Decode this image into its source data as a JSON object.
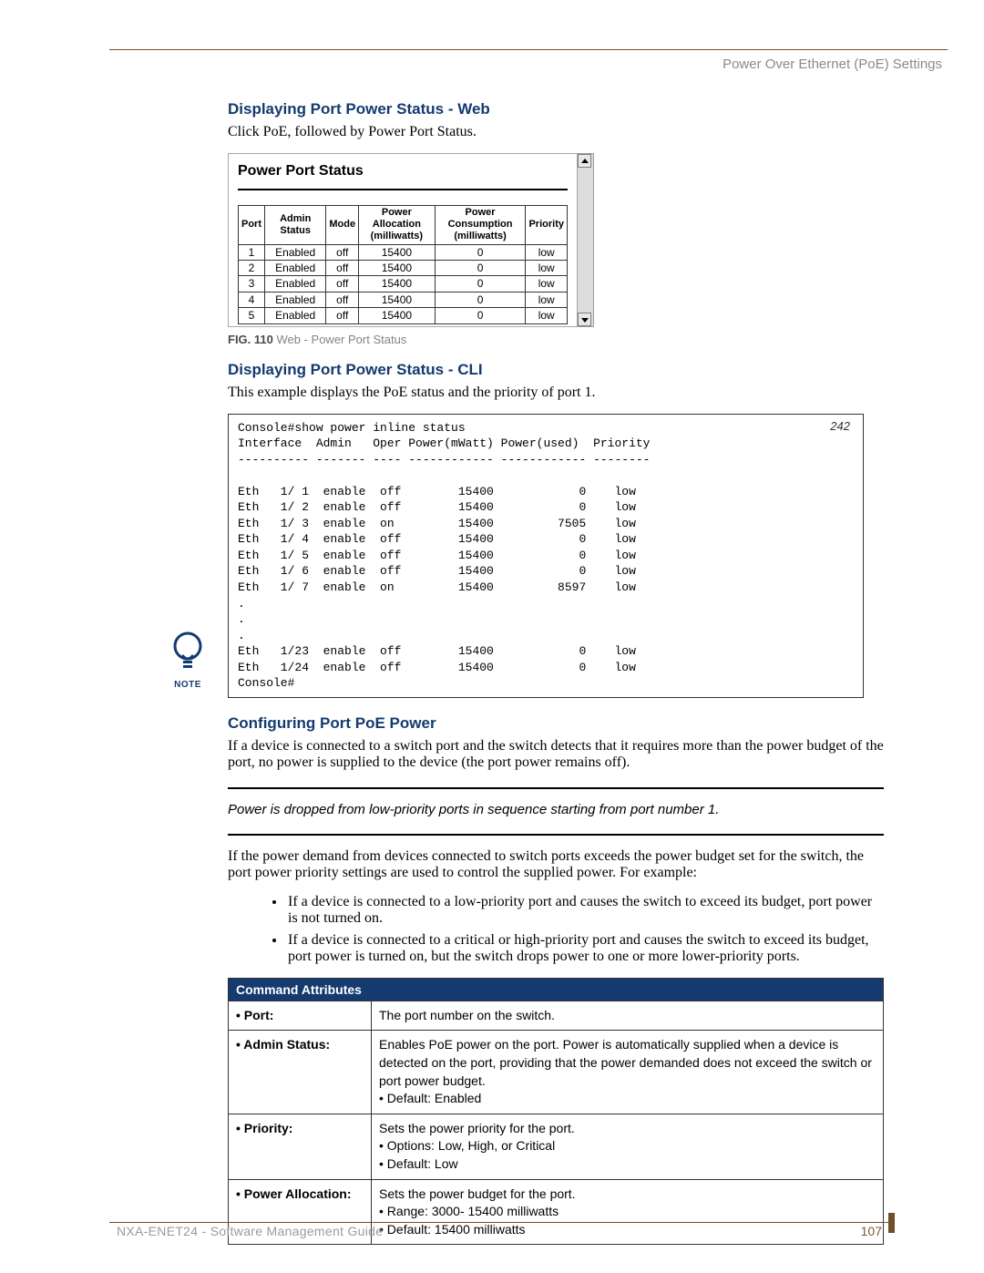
{
  "header": {
    "right": "Power Over Ethernet (PoE) Settings"
  },
  "sec1": {
    "h": "Displaying Port Power Status - Web",
    "p": "Click PoE, followed by Power Port Status.",
    "shot_title": "Power Port Status",
    "cols": {
      "c1": "Port",
      "c2": "Admin Status",
      "c3": "Mode",
      "c4a": "Power Allocation",
      "c4b": "(milliwatts)",
      "c5a": "Power Consumption",
      "c5b": "(milliwatts)",
      "c6": "Priority"
    },
    "rows": [
      {
        "p": "1",
        "a": "Enabled",
        "m": "off",
        "al": "15400",
        "co": "0",
        "pr": "low"
      },
      {
        "p": "2",
        "a": "Enabled",
        "m": "off",
        "al": "15400",
        "co": "0",
        "pr": "low"
      },
      {
        "p": "3",
        "a": "Enabled",
        "m": "off",
        "al": "15400",
        "co": "0",
        "pr": "low"
      },
      {
        "p": "4",
        "a": "Enabled",
        "m": "off",
        "al": "15400",
        "co": "0",
        "pr": "low"
      },
      {
        "p": "5",
        "a": "Enabled",
        "m": "off",
        "al": "15400",
        "co": "0",
        "pr": "low"
      }
    ],
    "caption_bold": "FIG. 110",
    "caption_rest": "  Web - Power Port Status"
  },
  "sec2": {
    "h": "Displaying Port Power Status - CLI",
    "p": "This example displays the PoE status and the priority of port 1.",
    "side_num": "242",
    "pre": "Console#show power inline status\nInterface  Admin   Oper Power(mWatt) Power(used)  Priority\n---------- ------- ---- ------------ ------------ --------\n\nEth   1/ 1  enable  off        15400            0    low\nEth   1/ 2  enable  off        15400            0    low\nEth   1/ 3  enable  on         15400         7505    low\nEth   1/ 4  enable  off        15400            0    low\nEth   1/ 5  enable  off        15400            0    low\nEth   1/ 6  enable  off        15400            0    low\nEth   1/ 7  enable  on         15400         8597    low\n.\n.\n.\nEth   1/23  enable  off        15400            0    low\nEth   1/24  enable  off        15400            0    low\nConsole#"
  },
  "sec3": {
    "h": "Configuring Port PoE Power",
    "p1": "If a device is connected to a switch port and the switch detects that it requires more than the power budget of the port, no power is supplied to the device (the port power remains off).",
    "note_label": "NOTE",
    "note_text": "Power is dropped from low-priority ports in sequence starting from port number 1.",
    "p2": "If the power demand from devices connected to switch ports exceeds the power budget set for the switch, the port power priority settings are used to control the supplied power. For example:",
    "b1": "If a device is connected to a low-priority port and causes the switch to exceed its budget, port power is not turned on.",
    "b2": "If a device is connected to a critical or high-priority port and causes the switch to exceed its budget, port power is turned on, but the switch drops power to one or more lower-priority ports."
  },
  "cmd": {
    "header": "Command Attributes",
    "rows": [
      {
        "k": "• Port:",
        "v": "The port number on the switch."
      },
      {
        "k": "• Admin Status:",
        "v": "Enables PoE power on the port. Power is automatically supplied when a device is detected on the port, providing that the power demanded does not exceed the switch or port power budget.\n• Default: Enabled"
      },
      {
        "k": "• Priority:",
        "v": "Sets the power priority for the port.\n• Options: Low, High, or Critical\n• Default: Low"
      },
      {
        "k": "• Power Allocation:",
        "v": "Sets the power budget for the port.\n• Range: 3000- 15400 milliwatts\n• Default: 15400 milliwatts"
      }
    ]
  },
  "footer": {
    "left": "NXA-ENET24 - Software Management Guide",
    "page": "107"
  }
}
